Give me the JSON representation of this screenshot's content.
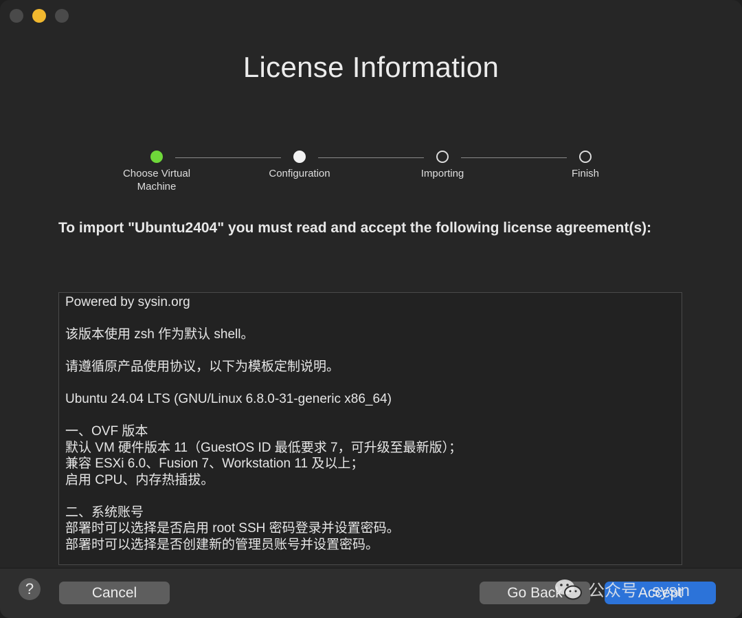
{
  "window": {
    "title": "License Information",
    "traffic_lights": [
      "close",
      "minimize",
      "zoom"
    ]
  },
  "stepper": {
    "steps": [
      {
        "label": "Choose Virtual\nMachine",
        "state": "done"
      },
      {
        "label": "Configuration",
        "state": "current"
      },
      {
        "label": "Importing",
        "state": "pending"
      },
      {
        "label": "Finish",
        "state": "pending"
      }
    ]
  },
  "prompt": "To import \"Ubuntu2404\" you must read and accept the following license agreement(s):",
  "license": {
    "lines": [
      "Powered by sysin.org",
      "",
      "该版本使用 zsh 作为默认 shell。",
      "",
      "请遵循原产品使用协议，以下为模板定制说明。",
      "",
      "Ubuntu 24.04 LTS (GNU/Linux 6.8.0-31-generic x86_64)",
      "",
      "一、OVF 版本",
      "默认 VM 硬件版本 11（GuestOS ID 最低要求 7，可升级至最新版）；",
      "兼容 ESXi 6.0、Fusion 7、Workstation 11 及以上；",
      "启用 CPU、内存热插拔。",
      "",
      "二、系统账号",
      "部署时可以选择是否启用 root SSH 密码登录并设置密码。",
      "部署时可以选择是否创建新的管理员账号并设置密码。"
    ]
  },
  "footer": {
    "help_label": "?",
    "cancel_label": "Cancel",
    "back_label": "Go Back",
    "accept_label": "Accept"
  },
  "watermark": {
    "text": "公众号 · sysin",
    "icon": "wechat-icon"
  },
  "colors": {
    "background": "#262626",
    "accent": "#2c73d9",
    "step_done": "#6fd83a",
    "minimize_light": "#f1b82f"
  }
}
